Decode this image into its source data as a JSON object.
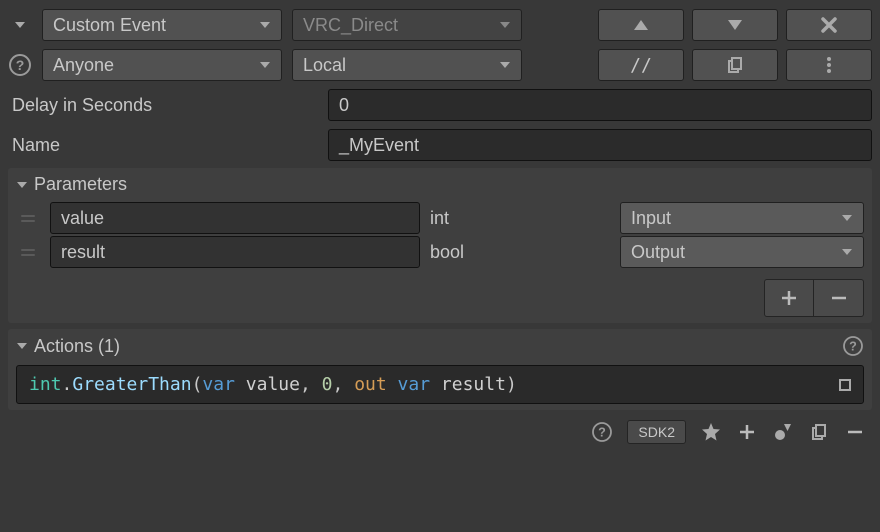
{
  "header": {
    "event_type": "Custom Event",
    "target": "VRC_Direct",
    "broadcast": "Anyone",
    "scope": "Local",
    "comment_btn": "//"
  },
  "fields": {
    "delay_label": "Delay in Seconds",
    "delay_value": "0",
    "name_label": "Name",
    "name_value": "_MyEvent"
  },
  "parameters": {
    "title": "Parameters",
    "items": [
      {
        "name": "value",
        "type": "int",
        "direction": "Input"
      },
      {
        "name": "result",
        "type": "bool",
        "direction": "Output"
      }
    ]
  },
  "actions": {
    "title": "Actions (1)",
    "line": {
      "type": "int",
      "dot": ".",
      "method": "GreaterThan",
      "open": "(",
      "kw1": "var ",
      "arg1": "value",
      "c1": ", ",
      "num": "0",
      "c2": ", ",
      "out": "out ",
      "kw2": "var ",
      "arg2": "result",
      "close": ")"
    }
  },
  "footer": {
    "sdk": "SDK2"
  }
}
